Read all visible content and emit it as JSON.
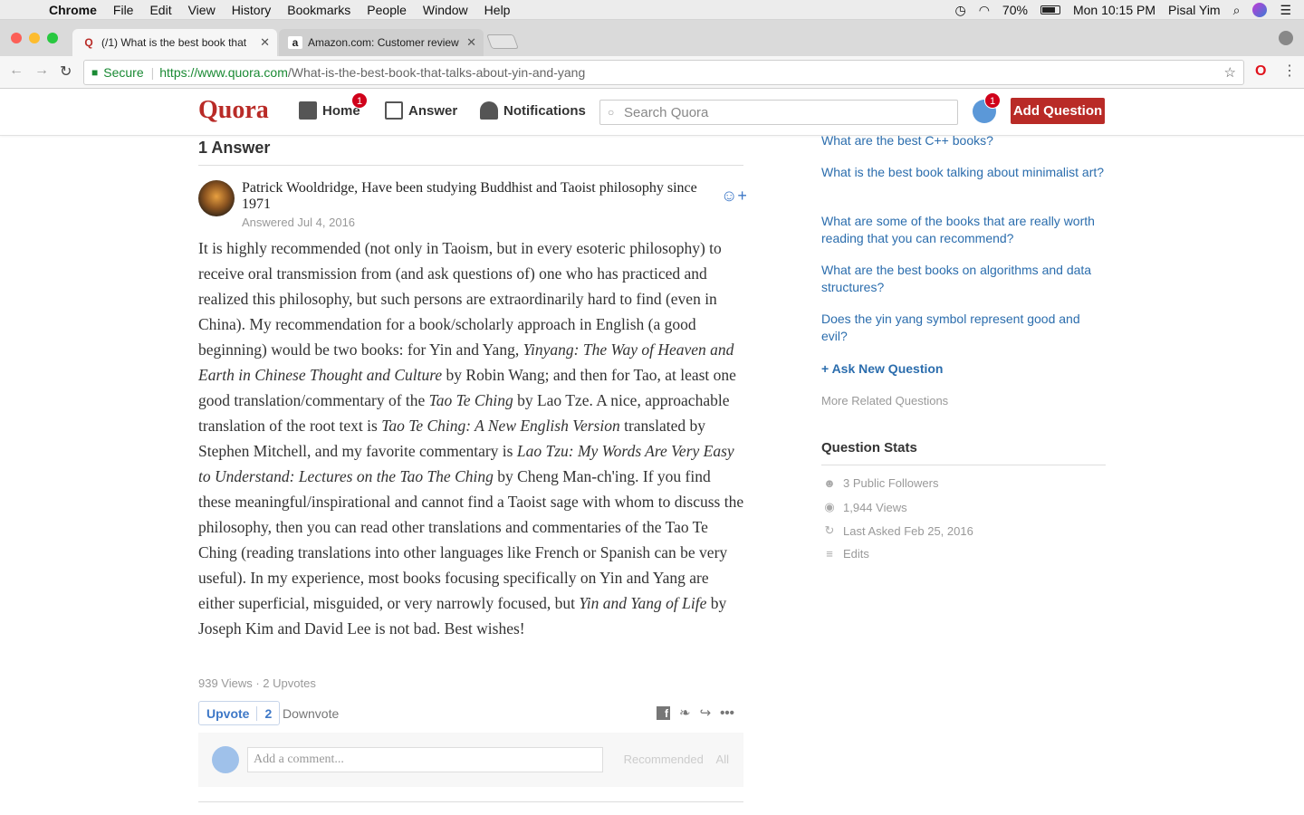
{
  "menubar": {
    "app": "Chrome",
    "items": [
      "File",
      "Edit",
      "View",
      "History",
      "Bookmarks",
      "People",
      "Window",
      "Help"
    ],
    "battery": "70%",
    "clock": "Mon 10:15 PM",
    "user": "Pisal Yim"
  },
  "tabs": [
    {
      "title": "(/1) What is the best book that",
      "favicon": "Q"
    },
    {
      "title": "Amazon.com: Customer review",
      "favicon": "a"
    }
  ],
  "omnibox": {
    "secure_label": "Secure",
    "url_host": "https://www.quora.com",
    "url_path": "/What-is-the-best-book-that-talks-about-yin-and-yang"
  },
  "header": {
    "logo": "Quora",
    "nav": [
      {
        "label": "Home",
        "badge": "1"
      },
      {
        "label": "Answer"
      },
      {
        "label": "Notifications"
      }
    ],
    "search_placeholder": "Search Quora",
    "profile_badge": "1",
    "add_question": "Add Question"
  },
  "answer": {
    "count_label": "1 Answer",
    "author": "Patrick Wooldridge, Have been studying Buddhist and Taoist philosophy since 1971",
    "answered": "Answered Jul 4, 2016",
    "body": [
      {
        "t": "It is highly recommended (not only in Taoism, but in every esoteric philosophy) to receive oral transmission from (and ask questions of) one who has practiced and realized this philosophy, but such persons are extraordinarily hard to find (even in China). My recommendation for a book/scholarly approach in English (a good beginning) would be two books: for Yin and Yang, "
      },
      {
        "t": "Yinyang: The Way of Heaven and Earth in Chinese Thought and Culture",
        "i": true
      },
      {
        "t": " by Robin Wang; and then for Tao, at least one good translation/commentary of the "
      },
      {
        "t": "Tao Te Ching",
        "i": true
      },
      {
        "t": " by Lao Tze. A nice, approachable translation of the root text is "
      },
      {
        "t": "Tao Te Ching: A New English Version",
        "i": true
      },
      {
        "t": " translated by Stephen Mitchell, and my favorite commentary is "
      },
      {
        "t": "Lao Tzu: My Words Are Very Easy to Understand: Lectures on the Tao The Ching",
        "i": true
      },
      {
        "t": " by Cheng Man-ch'ing. If you find these meaningful/inspirational and cannot find a Taoist sage with whom to discuss the philosophy, then you can read other translations and commentaries of the Tao Te Ching (reading translations into other languages like French or Spanish can be very useful). In my experience, most books focusing specifically on Yin and Yang are either superficial, misguided, or very narrowly focused, but "
      },
      {
        "t": "Yin and Yang of Life",
        "i": true
      },
      {
        "t": " by Joseph Kim and David Lee is not bad. Best wishes!"
      }
    ],
    "meta": "939 Views · 2 Upvotes",
    "upvote_label": "Upvote",
    "upvote_count": "2",
    "downvote_label": "Downvote",
    "comment_placeholder": "Add a comment...",
    "comment_sort": "Recommended",
    "comment_all": "All"
  },
  "sidebar": {
    "related": [
      "What are the best C++ books?",
      "What is the best book talking about minimalist art?",
      "What are some of the books that are really worth reading that you can recommend?",
      "What are the best books on algorithms and data structures?",
      "Does the yin yang symbol represent good and evil?"
    ],
    "ask_new": "Ask New Question",
    "more_related": "More Related Questions",
    "stats_title": "Question Stats",
    "stats": [
      {
        "icon": "followers-icon",
        "text": "3 Public Followers"
      },
      {
        "icon": "eye-icon",
        "text": "1,944 Views"
      },
      {
        "icon": "refresh-icon",
        "text": "Last Asked Feb 25, 2016"
      },
      {
        "icon": "edits-icon",
        "text": "Edits"
      }
    ]
  },
  "colors": {
    "quora_red": "#b92b27",
    "link_blue": "#2b6dad",
    "secure_green": "#1a8a34"
  }
}
